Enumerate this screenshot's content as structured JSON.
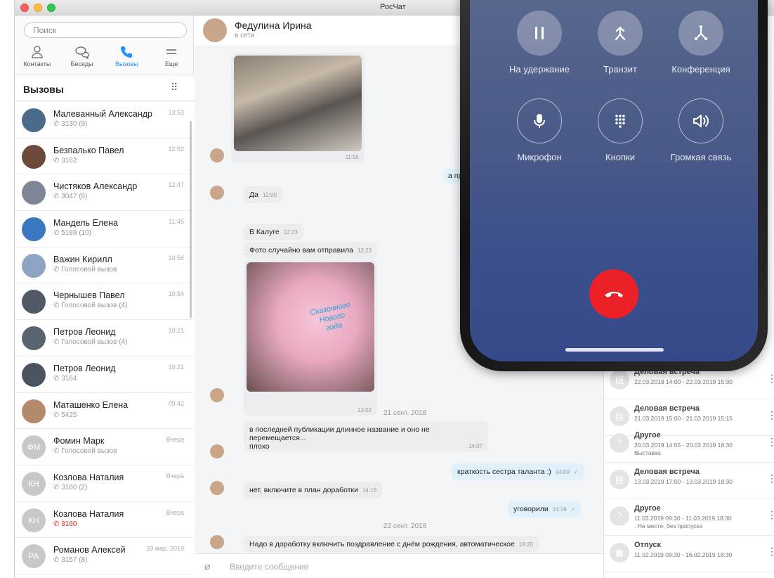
{
  "window": {
    "title": "РосЧат"
  },
  "sidebar": {
    "search_placeholder": "Поиск",
    "tabs": [
      {
        "label": "Контакты",
        "icon": "person-icon"
      },
      {
        "label": "Беседы",
        "icon": "chat-bubbles-icon"
      },
      {
        "label": "Вызовы",
        "icon": "phone-icon"
      },
      {
        "label": "Еще",
        "icon": "menu-icon"
      }
    ],
    "active_tab": "Вызовы",
    "section_title": "Вызовы",
    "calls": [
      {
        "name": "Малеванный Александр",
        "detail": "3130 (9)",
        "time": "13:53"
      },
      {
        "name": "Безпалько Павел",
        "detail": "3162",
        "time": "12:52"
      },
      {
        "name": "Чистяков Александр",
        "detail": "3047 (6)",
        "time": "12:47"
      },
      {
        "name": "Мандель Елена",
        "detail": "5188 (10)",
        "time": "11:45"
      },
      {
        "name": "Важин Кирилл",
        "detail": "Голосовой вызов",
        "time": "10:56"
      },
      {
        "name": "Чернышев Павел",
        "detail": "Голосовой вызов (4)",
        "time": "10:54"
      },
      {
        "name": "Петров Леонид",
        "detail": "Голосовой вызов (4)",
        "time": "10:21"
      },
      {
        "name": "Петров Леонид",
        "detail": "3164",
        "time": "10:21"
      },
      {
        "name": "Маташенко Елена",
        "detail": "5425",
        "time": "09:42"
      },
      {
        "name": "Фомин Марк",
        "detail": "Голосовой вызов",
        "time": "Вчера",
        "initials": "ФМ"
      },
      {
        "name": "Козлова Наталия",
        "detail": "3160 (2)",
        "time": "Вчера",
        "initials": "КН"
      },
      {
        "name": "Козлова Наталия",
        "detail": "3160",
        "time": "Вчера",
        "initials": "КН",
        "missed": true
      },
      {
        "name": "Романов Алексей",
        "detail": "3157 (8)",
        "time": "29 мар. 2019",
        "initials": "РА"
      }
    ]
  },
  "chat": {
    "contact_name": "Федулина Ирина",
    "status": "в сети",
    "messages": {
      "photo1_time": "11:55",
      "out_partial": "а пр",
      "m1": {
        "text": "Да",
        "time": "12:00"
      },
      "m2": {
        "text": "В Калуге",
        "time": "12:23"
      },
      "m3": {
        "text": "Фото случайно вам отправила",
        "time": "12:23"
      },
      "photo2_time": "13:02",
      "photo2_caption": "Сказочного Нового года",
      "date1": "21 сент. 2018",
      "m4": {
        "line1": "в последней публикации длинное название и оно не перемещается...",
        "line2": "плохо",
        "time": "14:07"
      },
      "m5": {
        "text": "краткость сестра таланта :)",
        "time": "14:09"
      },
      "m6": {
        "text": "нет, включите в план доработки",
        "time": "14:16"
      },
      "m7": {
        "text": "уговорили",
        "time": "14:19"
      },
      "date2": "22 сент. 2018",
      "m8": {
        "text": "Надо в доработку включить поздравление с днём рождения, автоматическое",
        "time": "18:20"
      }
    },
    "input_placeholder": "Введите сообщение"
  },
  "events": [
    {
      "title": "Деловая встреча",
      "dates": "22.03.2019 14:00 - 22.03.2019 15:30",
      "icon": "briefcase-icon"
    },
    {
      "title": "Деловая встреча",
      "dates": "21.03.2019 15:00 - 21.03.2019 15:15",
      "icon": "briefcase-icon"
    },
    {
      "title": "Другое",
      "dates": "20.03.2019 14:55 - 20.03.2019 18:30",
      "note": "Выставка",
      "icon": "question-icon"
    },
    {
      "title": "Деловая встреча",
      "dates": "13.03.2019 17:00 - 13.03.2019 18:30",
      "icon": "briefcase-icon"
    },
    {
      "title": "Другое",
      "dates": "11.03.2019 09:30 - 11.03.2019 18:30",
      "note": ". Не месте, без пропуска",
      "icon": "question-icon"
    },
    {
      "title": "Отпуск",
      "dates": "11.02.2019 09:30 - 16.02.2019 18:30",
      "icon": "suitcase-icon"
    }
  ],
  "phone_call": {
    "buttons": [
      {
        "label": "На удержание",
        "icon": "pause-icon"
      },
      {
        "label": "Транзит",
        "icon": "transfer-icon"
      },
      {
        "label": "Конференция",
        "icon": "conference-icon"
      },
      {
        "label": "Микрофон",
        "icon": "microphone-icon"
      },
      {
        "label": "Кнопки",
        "icon": "keypad-icon"
      },
      {
        "label": "Громкая связь",
        "icon": "speaker-icon"
      }
    ],
    "end_call_color": "#eb2127"
  }
}
